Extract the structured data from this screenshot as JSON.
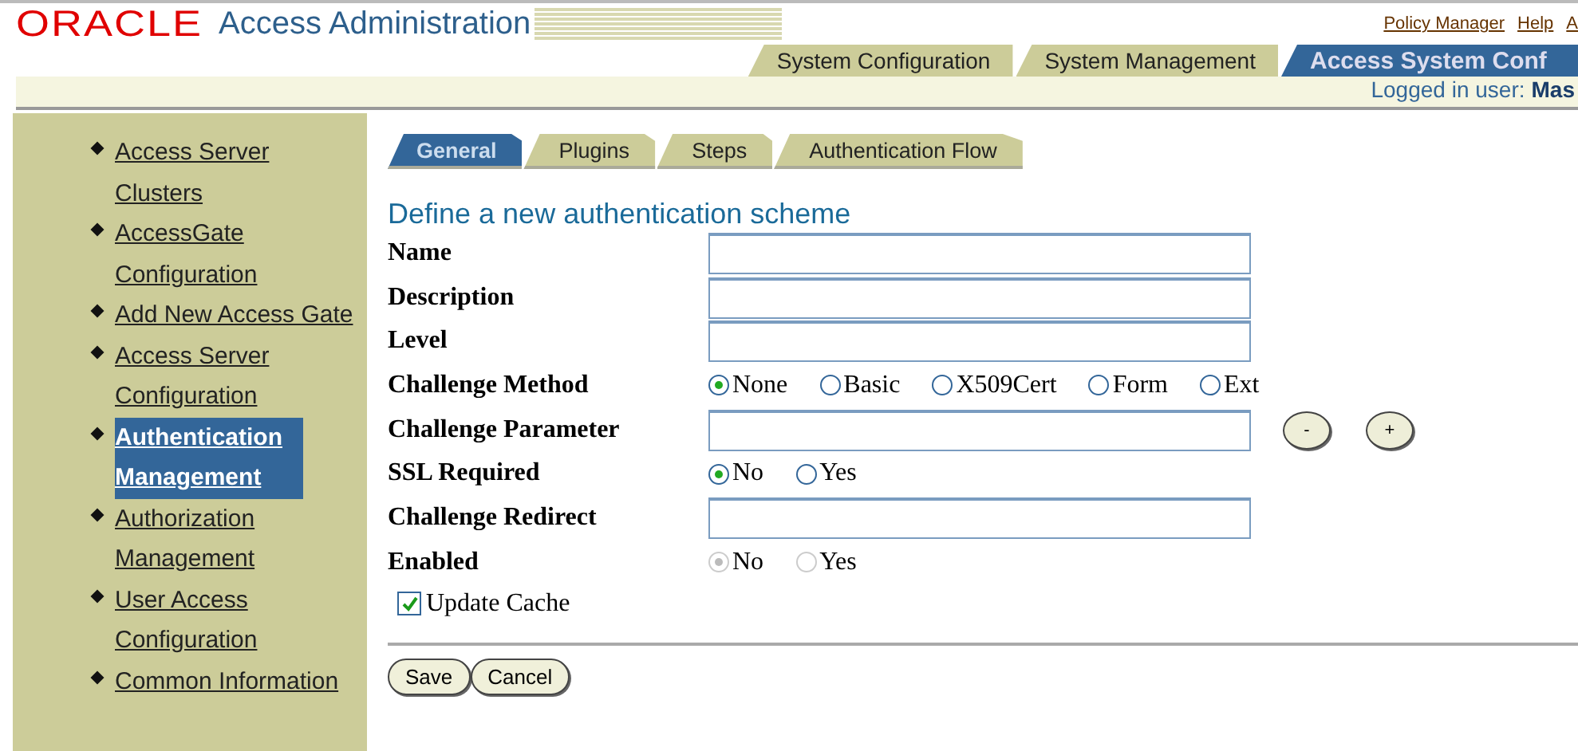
{
  "header": {
    "logo": "ORACLE",
    "title": "Access Administration",
    "links": [
      "Policy Manager",
      "Help",
      "A"
    ]
  },
  "top_tabs": [
    {
      "label": "System Configuration",
      "selected": false
    },
    {
      "label": "System Management",
      "selected": false
    },
    {
      "label": "Access System Conf",
      "selected": true
    }
  ],
  "user_bar": {
    "label": "Logged in user:",
    "user": "Mas"
  },
  "sidebar": {
    "items": [
      {
        "label": "Access Server Clusters",
        "selected": false
      },
      {
        "label": "AccessGate Configuration",
        "selected": false
      },
      {
        "label": "Add New Access Gate",
        "selected": false
      },
      {
        "label": "Access Server Configuration",
        "selected": false
      },
      {
        "label": "Authentication Management",
        "selected": true
      },
      {
        "label": "Authorization Management",
        "selected": false
      },
      {
        "label": "User Access Configuration",
        "selected": false
      },
      {
        "label": "Common Information",
        "selected": false
      }
    ]
  },
  "tabs": [
    {
      "label": "General",
      "selected": true
    },
    {
      "label": "Plugins",
      "selected": false
    },
    {
      "label": "Steps",
      "selected": false
    },
    {
      "label": "Authentication Flow",
      "selected": false
    }
  ],
  "form": {
    "heading": "Define a new authentication scheme",
    "rows": [
      {
        "kind": "text",
        "label": "Name"
      },
      {
        "kind": "text",
        "label": "Description"
      },
      {
        "kind": "text",
        "label": "Level"
      },
      {
        "kind": "radio",
        "label": "Challenge Method",
        "disabled": false,
        "options": [
          {
            "label": "None",
            "selected": true
          },
          {
            "label": "Basic",
            "selected": false
          },
          {
            "label": "X509Cert",
            "selected": false
          },
          {
            "label": "Form",
            "selected": false
          },
          {
            "label": "Ext",
            "selected": false
          }
        ]
      },
      {
        "kind": "param",
        "label": "Challenge Parameter",
        "buttons": [
          "-",
          "+"
        ]
      },
      {
        "kind": "radio",
        "label": "SSL Required",
        "disabled": false,
        "options": [
          {
            "label": "No",
            "selected": true
          },
          {
            "label": "Yes",
            "selected": false
          }
        ]
      },
      {
        "kind": "text",
        "label": "Challenge Redirect"
      },
      {
        "kind": "radio",
        "label": "Enabled",
        "disabled": true,
        "options": [
          {
            "label": "No",
            "selected": true
          },
          {
            "label": "Yes",
            "selected": false
          }
        ]
      }
    ],
    "checkbox": {
      "label": "Update Cache",
      "checked": true
    }
  },
  "buttons": [
    "Save",
    "Cancel"
  ]
}
